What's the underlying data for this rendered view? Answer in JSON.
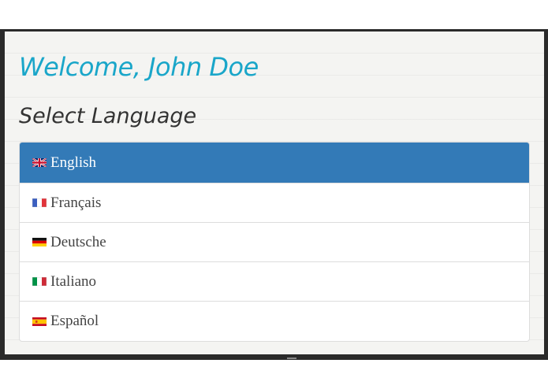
{
  "header": {
    "welcome": "Welcome, John Doe",
    "select_title": "Select Language"
  },
  "languages": [
    {
      "label": "English",
      "flag": "uk-flag-icon",
      "active": true
    },
    {
      "label": "Français",
      "flag": "france-flag-icon",
      "active": false
    },
    {
      "label": "Deutsche",
      "flag": "germany-flag-icon",
      "active": false
    },
    {
      "label": "Italiano",
      "flag": "italy-flag-icon",
      "active": false
    },
    {
      "label": "Español",
      "flag": "spain-flag-icon",
      "active": false
    }
  ],
  "colors": {
    "welcome": "#1aa6c9",
    "active_bg": "#337ab7",
    "text": "#444444"
  }
}
